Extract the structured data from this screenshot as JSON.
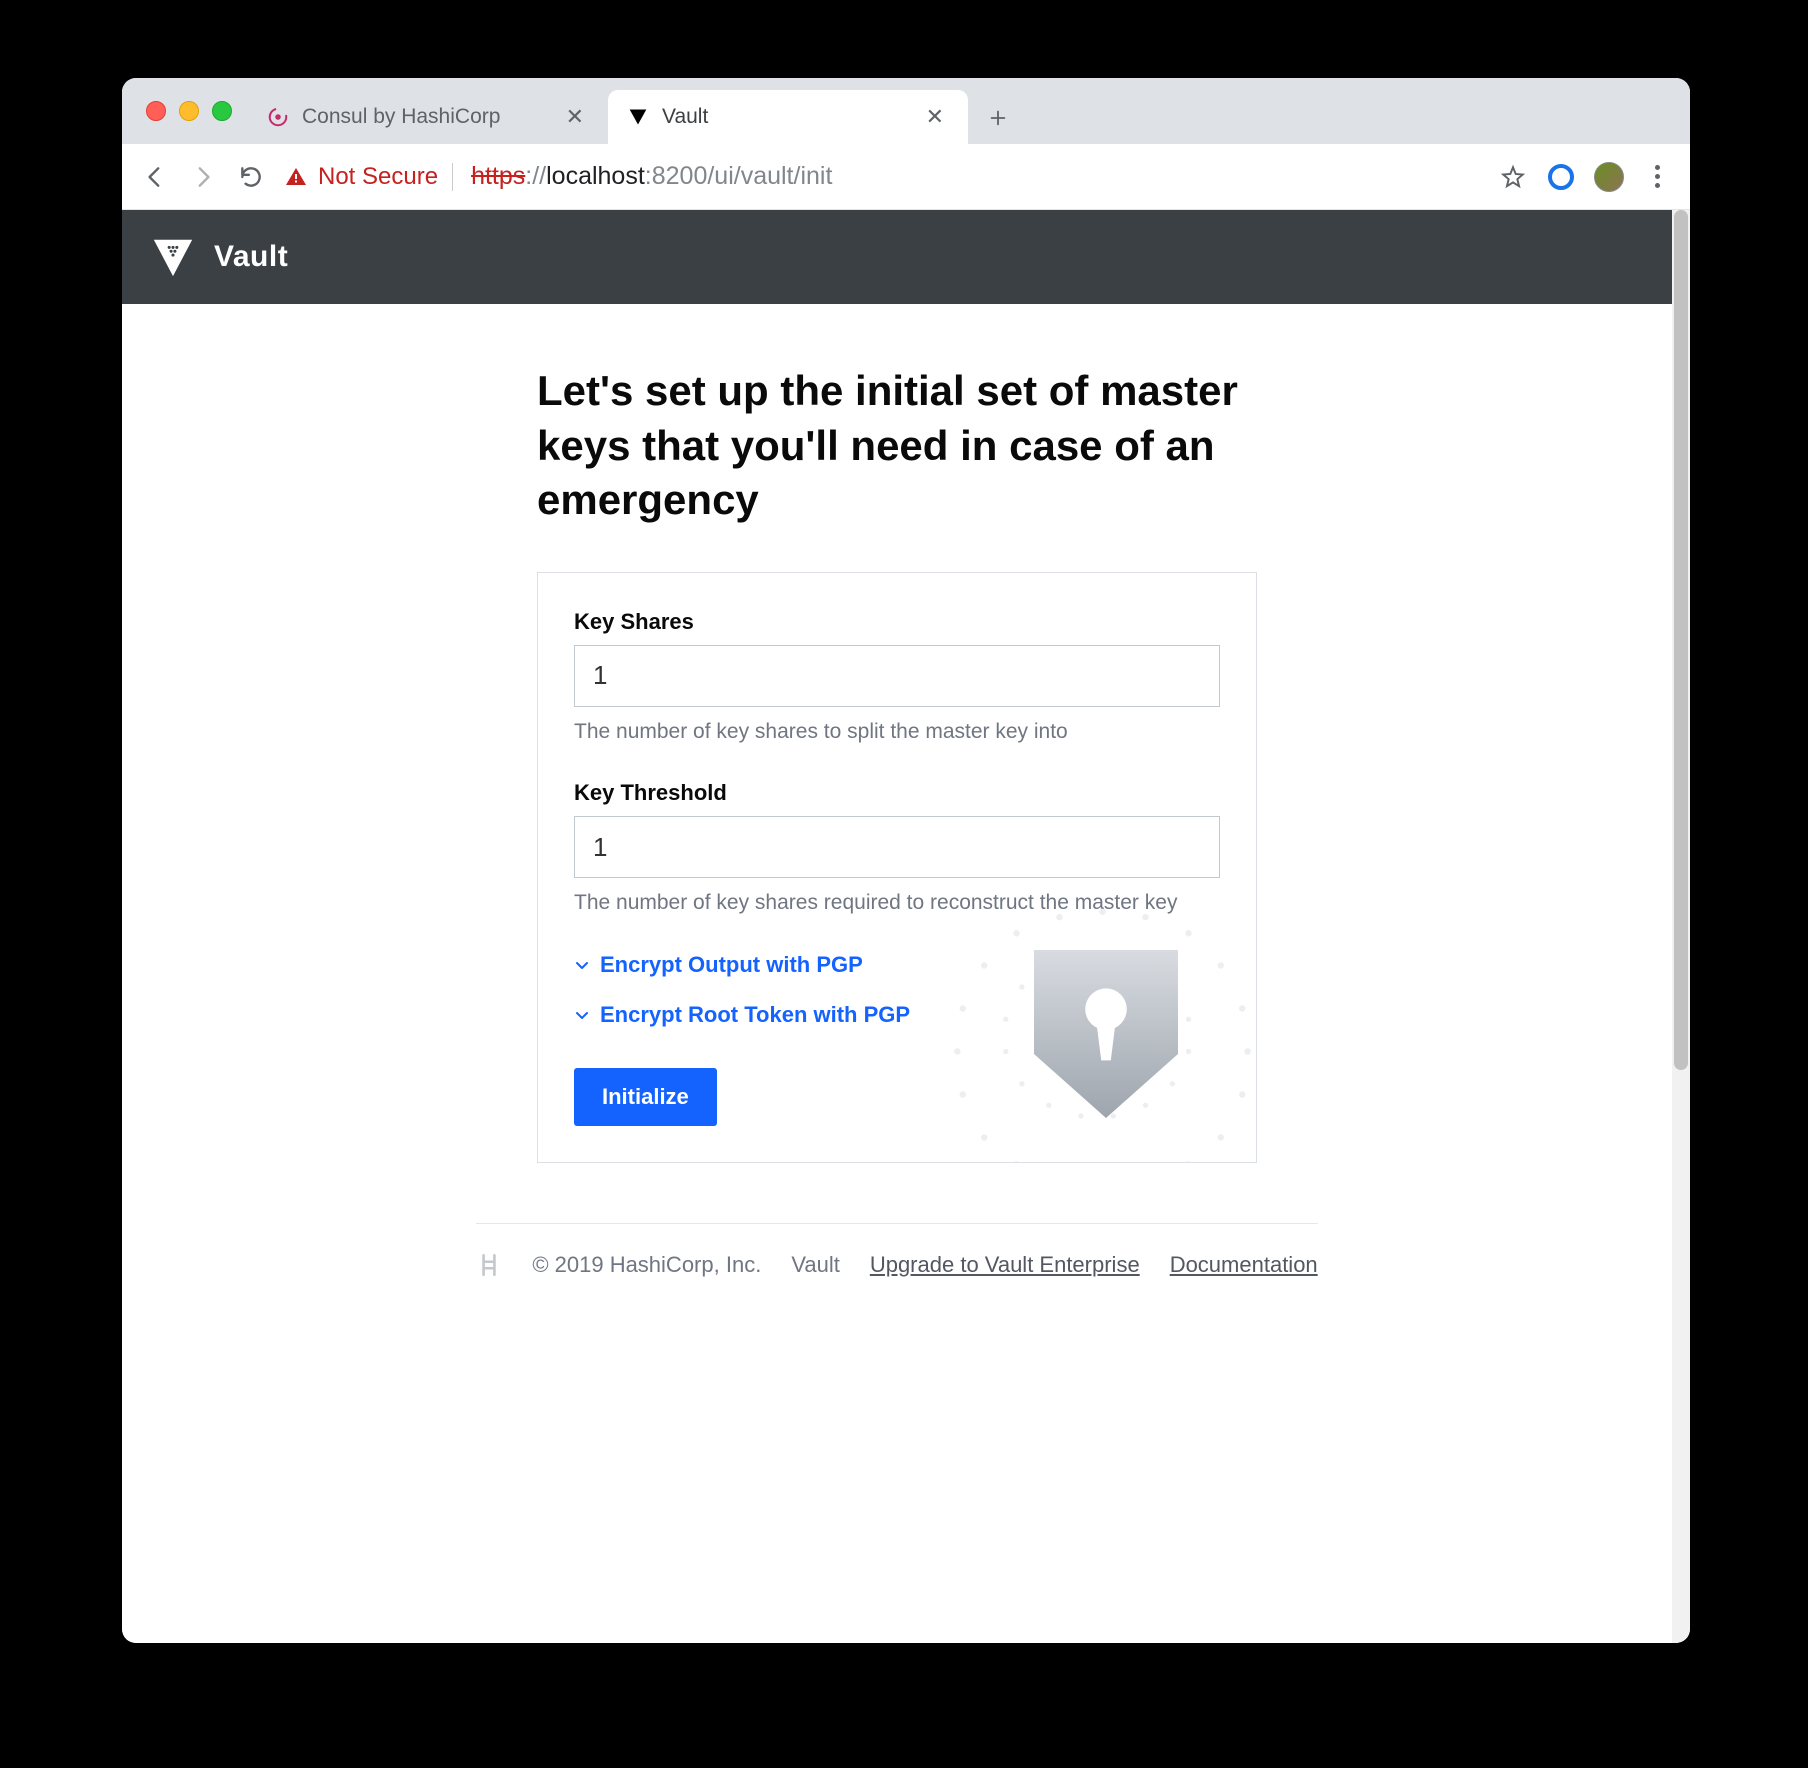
{
  "browser": {
    "tabs": [
      {
        "title": "Consul by HashiCorp",
        "active": false
      },
      {
        "title": "Vault",
        "active": true
      }
    ],
    "security_label": "Not Secure",
    "url_scheme": "https",
    "url_sep": "://",
    "url_host": "localhost",
    "url_port": ":8200",
    "url_path": "/ui/vault/init"
  },
  "header": {
    "brand": "Vault"
  },
  "page": {
    "title": "Let's set up the initial set of master keys that you'll need in case of an emergency",
    "fields": {
      "key_shares": {
        "label": "Key Shares",
        "value": "1",
        "help": "The number of key shares to split the master key into"
      },
      "key_threshold": {
        "label": "Key Threshold",
        "value": "1",
        "help": "The number of key shares required to reconstruct the master key"
      }
    },
    "toggles": {
      "pgp_output": "Encrypt Output with PGP",
      "pgp_root": "Encrypt Root Token with PGP"
    },
    "submit": "Initialize"
  },
  "footer": {
    "copyright": "© 2019 HashiCorp, Inc.",
    "product": "Vault",
    "upgrade": "Upgrade to Vault Enterprise",
    "docs": "Documentation"
  }
}
